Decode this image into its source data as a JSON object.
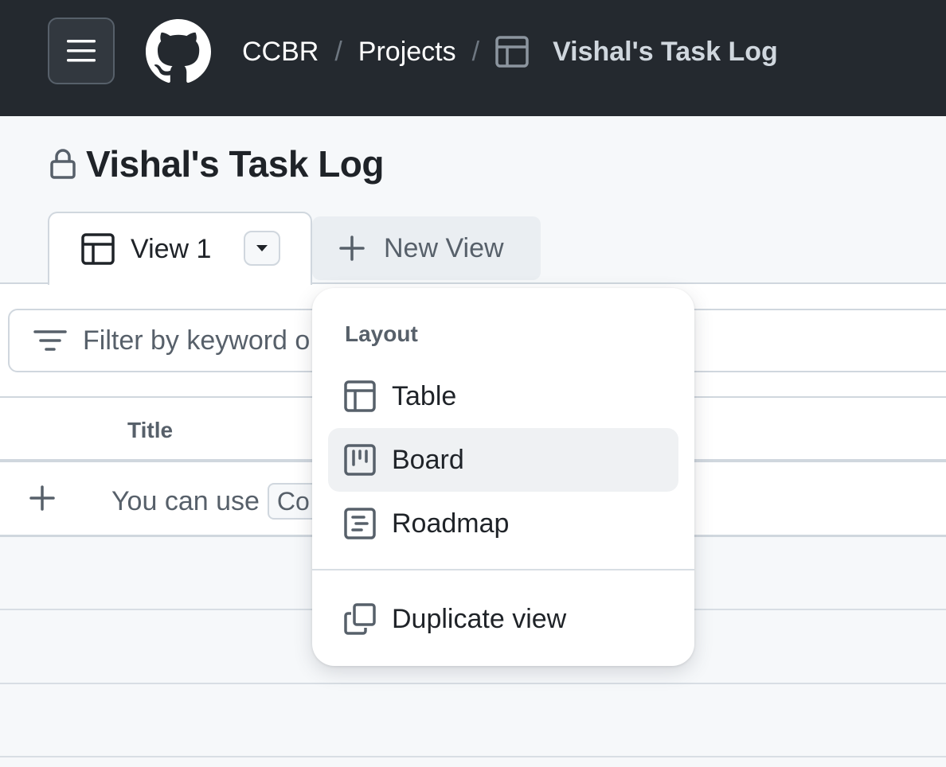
{
  "header": {
    "breadcrumb": {
      "org": "CCBR",
      "separator": "/",
      "section": "Projects",
      "project": "Vishal's Task Log"
    },
    "icons": [
      "hamburger-menu-icon",
      "github-logo-icon",
      "table-icon"
    ]
  },
  "page": {
    "title": "Vishal's Task Log",
    "visibility_icon": "lock-icon"
  },
  "tabs": {
    "active": {
      "label": "View 1",
      "icon": "table-icon"
    },
    "new_view_label": "New View"
  },
  "filter": {
    "placeholder": "Filter by keyword o"
  },
  "table": {
    "columns": [
      "Title"
    ],
    "add_row_hint": "You can use",
    "code_hint": "Co"
  },
  "layout_menu": {
    "header": "Layout",
    "items": [
      {
        "label": "Table",
        "icon": "table-icon"
      },
      {
        "label": "Board",
        "icon": "board-icon",
        "highlighted": true
      },
      {
        "label": "Roadmap",
        "icon": "roadmap-icon"
      }
    ],
    "actions": [
      {
        "label": "Duplicate view",
        "icon": "duplicate-icon"
      }
    ]
  },
  "colors": {
    "header_bg": "#24292f",
    "page_bg": "#f6f8fa",
    "border": "#d0d7de",
    "muted_text": "#57606a",
    "highlight": "#eff1f3"
  }
}
